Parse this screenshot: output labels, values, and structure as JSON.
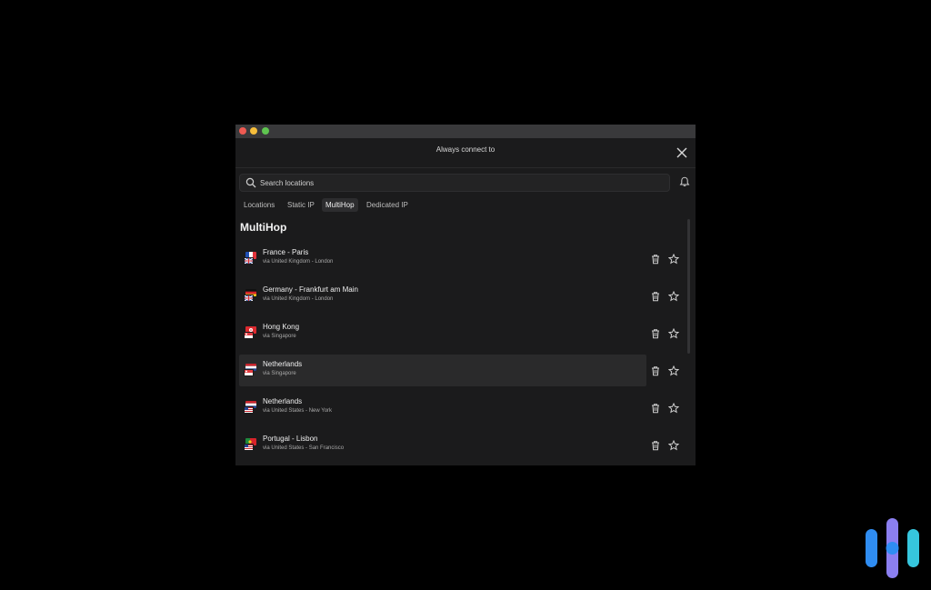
{
  "window": {
    "title": "Always connect to"
  },
  "search": {
    "placeholder": "Search locations"
  },
  "tabs": [
    {
      "label": "Locations",
      "active": false
    },
    {
      "label": "Static IP",
      "active": false
    },
    {
      "label": "MultiHop",
      "active": true
    },
    {
      "label": "Dedicated IP",
      "active": false
    }
  ],
  "section": {
    "title": "MultiHop"
  },
  "locations": [
    {
      "title": "France - Paris",
      "via": "via United Kingdom - London",
      "flag": "france",
      "via_flag": "uk",
      "highlighted": false
    },
    {
      "title": "Germany - Frankfurt am Main",
      "via": "via United Kingdom - London",
      "flag": "germany",
      "via_flag": "uk",
      "highlighted": false
    },
    {
      "title": "Hong Kong",
      "via": "via Singapore",
      "flag": "hong-kong",
      "via_flag": "singapore",
      "highlighted": false
    },
    {
      "title": "Netherlands",
      "via": "via Singapore",
      "flag": "netherlands",
      "via_flag": "singapore",
      "highlighted": true
    },
    {
      "title": "Netherlands",
      "via": "via United States - New York",
      "flag": "netherlands",
      "via_flag": "usa",
      "highlighted": false
    },
    {
      "title": "Portugal - Lisbon",
      "via": "via United States - San Francisco",
      "flag": "portugal",
      "via_flag": "usa",
      "highlighted": false
    }
  ],
  "icons": {
    "close": "close-icon",
    "search": "search-icon",
    "bell": "bell-icon",
    "delete": "trash-icon",
    "favorite": "star-icon",
    "logo": "brand-logo-icon"
  },
  "colors": {
    "background": "#000000",
    "window_bg": "#1b1b1c",
    "titlebar": "#39393b",
    "highlight_row": "#2a2a2b",
    "logo_blue": "#2f8df2",
    "logo_purple": "#8b7ff0",
    "logo_teal": "#36c6dd"
  }
}
